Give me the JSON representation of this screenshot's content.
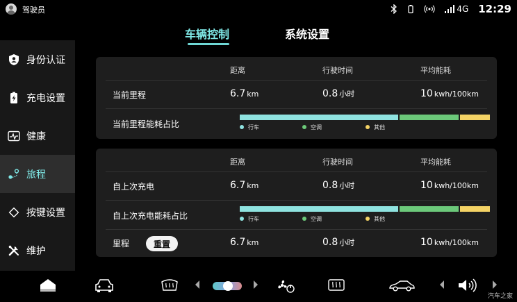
{
  "status": {
    "user": "驾驶员",
    "network": "4G",
    "time": "12:29"
  },
  "tabs": [
    {
      "label": "车辆控制",
      "active": true
    },
    {
      "label": "系统设置",
      "active": false
    }
  ],
  "sidebar": {
    "items": [
      {
        "label": "身份认证",
        "icon": "shield-user-icon"
      },
      {
        "label": "充电设置",
        "icon": "charge-icon"
      },
      {
        "label": "健康",
        "icon": "health-icon"
      },
      {
        "label": "旅程",
        "icon": "trip-icon",
        "active": true
      },
      {
        "label": "按键设置",
        "icon": "diamond-icon"
      },
      {
        "label": "维护",
        "icon": "tools-icon"
      }
    ]
  },
  "headers": {
    "distance": "距离",
    "drive_time": "行驶时间",
    "avg_energy": "平均能耗"
  },
  "current": {
    "label": "当前里程",
    "distance": "6.7",
    "distance_unit": "km",
    "time": "0.8",
    "time_unit": "小时",
    "energy": "10",
    "energy_unit": "kwh/100km",
    "ratio_label": "当前里程能耗占比",
    "ratio": {
      "drive": 0.64,
      "ac": 0.24,
      "other": 0.12
    }
  },
  "since_charge": {
    "label": "自上次充电",
    "distance": "6.7",
    "distance_unit": "km",
    "time": "0.8",
    "time_unit": "小时",
    "energy": "10",
    "energy_unit": "kwh/100km",
    "ratio_label": "自上次充电能耗占比",
    "ratio": {
      "drive": 0.64,
      "ac": 0.24,
      "other": 0.12
    }
  },
  "trip": {
    "label": "里程",
    "reset_label": "重置",
    "distance": "6.7",
    "distance_unit": "km",
    "time": "0.8",
    "time_unit": "小时",
    "energy": "10",
    "energy_unit": "kwh/100km"
  },
  "legend": {
    "drive": "行车",
    "ac": "空调",
    "other": "其他"
  },
  "colors": {
    "drive": "#8fe3e0",
    "ac": "#6cc97a",
    "other": "#f4d365",
    "accent": "#7fe8e6"
  },
  "dock_icons": [
    "home-icon",
    "car-icon",
    "rear-defrost-icon",
    "fan-power-icon",
    "front-defrost-icon",
    "car-side-icon",
    "volume-icon"
  ],
  "watermark": "汽车之家"
}
